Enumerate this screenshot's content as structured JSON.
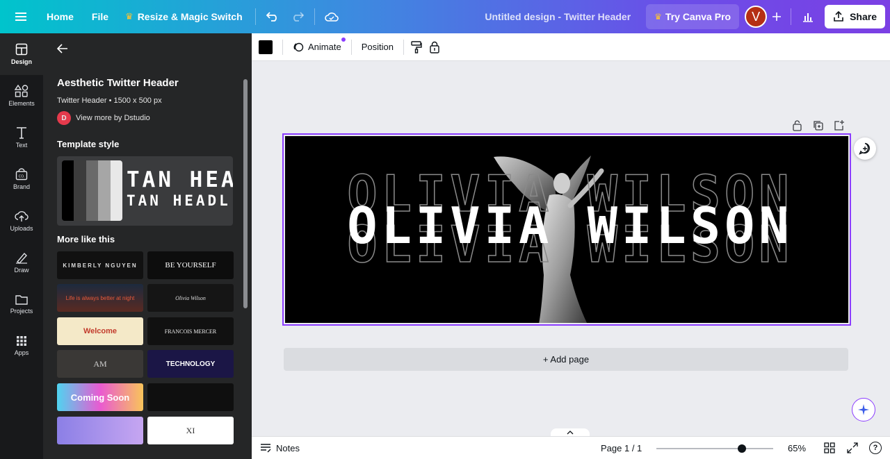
{
  "topbar": {
    "home": "Home",
    "file": "File",
    "resize": "Resize & Magic Switch",
    "title": "Untitled design - Twitter Header",
    "try_pro": "Try Canva Pro",
    "avatar_letter": "V",
    "share": "Share"
  },
  "rail": {
    "items": [
      {
        "label": "Design",
        "icon": "layout-icon"
      },
      {
        "label": "Elements",
        "icon": "shapes-icon"
      },
      {
        "label": "Text",
        "icon": "text-icon"
      },
      {
        "label": "Brand",
        "icon": "brand-icon"
      },
      {
        "label": "Uploads",
        "icon": "upload-cloud-icon"
      },
      {
        "label": "Draw",
        "icon": "draw-icon"
      },
      {
        "label": "Projects",
        "icon": "folder-icon"
      },
      {
        "label": "Apps",
        "icon": "apps-grid-icon"
      }
    ]
  },
  "panel": {
    "title": "Aesthetic Twitter Header",
    "subtitle": "Twitter Header • 1500 x 500 px",
    "author_initial": "D",
    "author": "View more by Dstudio",
    "template_style": "Template style",
    "style_preview_text": "TAN HEA",
    "style_preview_text2": "TAN HEADL",
    "more_like_this": "More like this",
    "thumbnails": [
      {
        "text": "KIMBERLY NGUYEN"
      },
      {
        "text": "BE YOURSELF"
      },
      {
        "text": "Life is always better at night"
      },
      {
        "text": "Olivia Wilson"
      },
      {
        "text": "Welcome"
      },
      {
        "text": "FRANCOIS MERCER"
      },
      {
        "text": "AM"
      },
      {
        "text": "TECHNOLOGY"
      },
      {
        "text": "Coming Soon"
      },
      {
        "text": ""
      },
      {
        "text": ""
      },
      {
        "text": "XI"
      }
    ]
  },
  "context_bar": {
    "color": "#000000",
    "animate": "Animate",
    "position": "Position"
  },
  "design": {
    "name": "OLIVIA WILSON"
  },
  "canvas": {
    "add_page": "+ Add page"
  },
  "bottombar": {
    "notes": "Notes",
    "page": "Page 1 / 1",
    "zoom": "65%",
    "zoom_level": 0.65
  },
  "colors": {
    "accent": "#8b3dff",
    "rail_bg": "#18191b",
    "panel_bg": "#252627"
  }
}
